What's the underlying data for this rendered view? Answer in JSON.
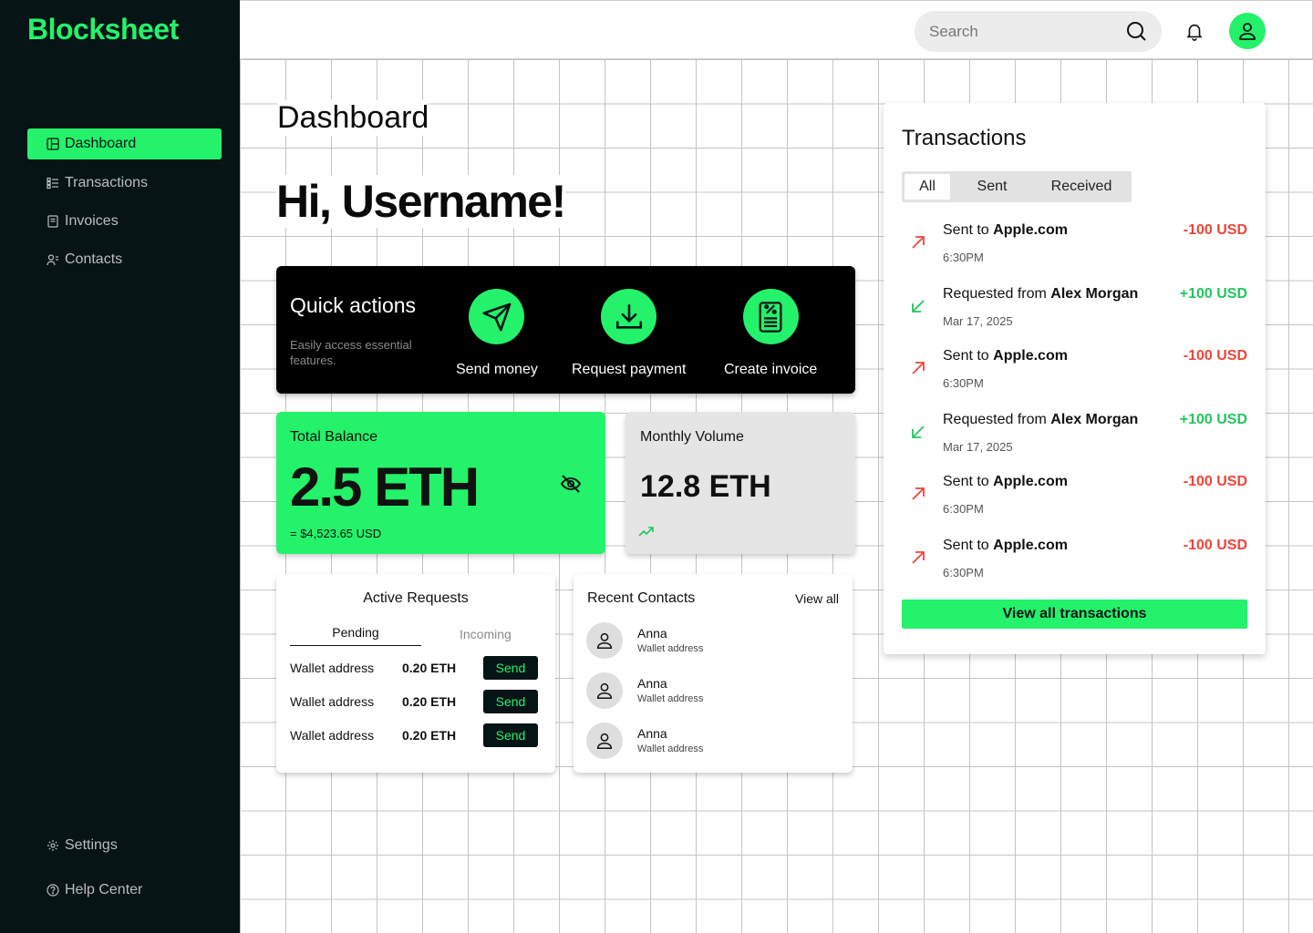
{
  "app": {
    "brand": "Blockheet"
  },
  "sidebar": {
    "items": [
      {
        "label": "Dashboard",
        "icon": "layout-icon",
        "active": true
      },
      {
        "label": "Transactions",
        "icon": "list-icon"
      },
      {
        "label": "Invoices",
        "icon": "document-icon"
      },
      {
        "label": "Contacts",
        "icon": "users-icon"
      }
    ],
    "bottom": [
      {
        "label": "Settings",
        "icon": "gear-icon"
      },
      {
        "label": "Help Center",
        "icon": "help-icon"
      }
    ]
  },
  "topbar": {
    "search_placeholder": "Search"
  },
  "main": {
    "title": "Dashboard",
    "greeting": "Hi, Username!",
    "quick_actions": {
      "title": "Quick actions",
      "subtitle": "Easily access essential features.",
      "actions": [
        {
          "label": "Send money",
          "icon": "send-icon"
        },
        {
          "label": "Request payment",
          "icon": "download-icon"
        },
        {
          "label": "Create invoice",
          "icon": "invoice-icon"
        }
      ]
    },
    "balance": {
      "title": "Total Balance",
      "value": "2.5 ETH",
      "usd": "= $4,523.65 USD"
    },
    "volume": {
      "title": "Monthly Volume",
      "value": "12.8 ETH"
    },
    "requests": {
      "title": "Active Requests",
      "tabs": [
        "Pending",
        "Incoming"
      ],
      "rows": [
        {
          "address": "Wallet address",
          "amount": "0.20 ETH",
          "action": "Send"
        },
        {
          "address": "Wallet address",
          "amount": "0.20 ETH",
          "action": "Send"
        },
        {
          "address": "Wallet address",
          "amount": "0.20 ETH",
          "action": "Send"
        }
      ]
    },
    "contacts": {
      "title": "Recent Contacts",
      "view_all": "View all",
      "items": [
        {
          "name": "Anna",
          "sub": "Wallet address"
        },
        {
          "name": "Anna",
          "sub": "Wallet address"
        },
        {
          "name": "Anna",
          "sub": "Wallet address"
        }
      ]
    }
  },
  "transactions": {
    "title": "Transactions",
    "tabs": [
      "All",
      "Sent",
      "Received"
    ],
    "rows": [
      {
        "prefix": "Sent to",
        "party": "Apple.com",
        "sub": "6:30PM",
        "amount": "-100 USD"
      },
      {
        "prefix": "Requested from",
        "party": "Alex Morgan",
        "sub": "Mar 17, 2025",
        "amount": "+100 USD"
      },
      {
        "prefix": "Sent to",
        "party": "Apple.com",
        "sub": "6:30PM",
        "amount": "-100 USD"
      },
      {
        "prefix": "Requested from",
        "party": "Alex Morgan",
        "sub": "Mar 17, 2025",
        "amount": "+100 USD"
      },
      {
        "prefix": "Sent to",
        "party": "Apple.com",
        "sub": "6:30PM",
        "amount": "-100 USD"
      },
      {
        "prefix": "Sent to",
        "party": "Apple.com",
        "sub": "6:30PM",
        "amount": "-100 USD"
      }
    ],
    "view_all": "View all transactions"
  },
  "colors": {
    "accent": "#24f26a",
    "sidebar": "#061416",
    "negative": "#f04438",
    "positive": "#22c55e"
  }
}
